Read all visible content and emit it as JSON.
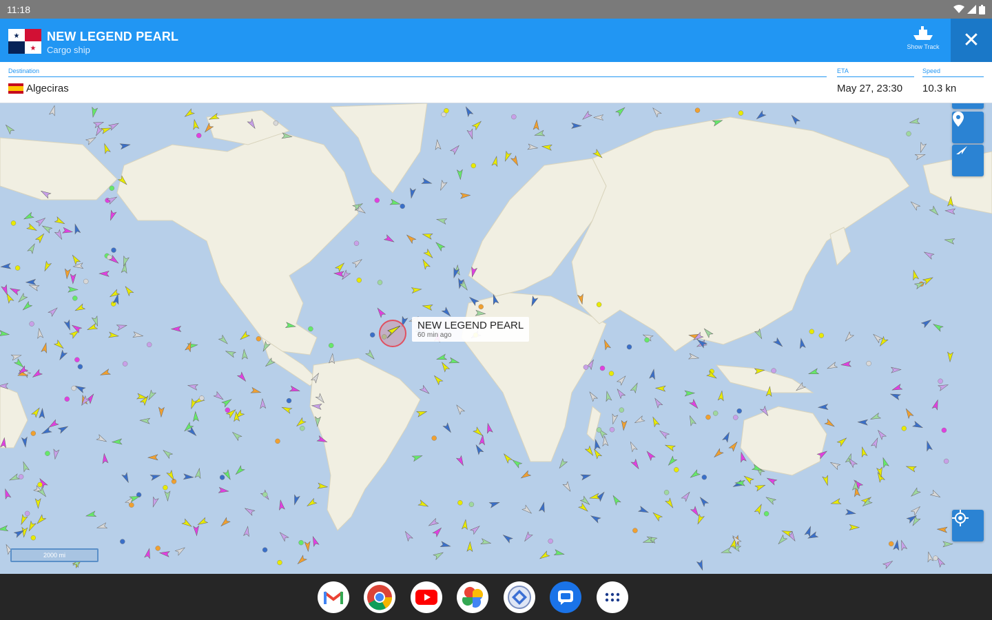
{
  "status_bar": {
    "time": "11:18"
  },
  "header": {
    "ship_name": "NEW LEGEND PEARL",
    "ship_type": "Cargo ship",
    "show_track_label": "Show Track",
    "close_label": "✕"
  },
  "info": {
    "destination_label": "Destination",
    "destination_value": "Algeciras",
    "eta_label": "ETA",
    "eta_value": "May 27, 23:30",
    "speed_label": "Speed",
    "speed_value": "10.3 kn"
  },
  "map": {
    "selected_label": "NEW LEGEND PEARL",
    "selected_sub": "60 min ago",
    "scale_text": "2000 mi"
  },
  "colors": {
    "header_blue": "#2196f3",
    "ocean": "#b7cfe9",
    "land": "#f1efe2"
  },
  "taskbar": {
    "apps": [
      "gmail-icon",
      "chrome-icon",
      "youtube-icon",
      "photos-icon",
      "files-icon",
      "messages-icon",
      "app-launcher-icon"
    ]
  }
}
